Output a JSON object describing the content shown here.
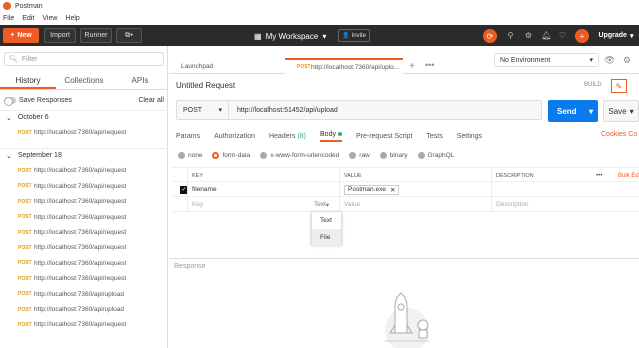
{
  "titlebar": {
    "app_name": "Postman"
  },
  "menu": [
    "File",
    "Edit",
    "View",
    "Help"
  ],
  "header": {
    "new_label": "New",
    "import_label": "Import",
    "runner_label": "Runner",
    "workspace_label": "My Workspace",
    "invite_label": "Invite",
    "upgrade_label": "Upgrade"
  },
  "sidebar": {
    "filter_placeholder": "Filter",
    "tabs": [
      "History",
      "Collections",
      "APIs"
    ],
    "save_responses_label": "Save Responses",
    "clear_all_label": "Clear all",
    "groups": [
      {
        "date": "October 6",
        "items": [
          {
            "method": "POST",
            "url": "http://localhost:7360/api/request"
          }
        ]
      },
      {
        "date": "September 18",
        "items": [
          {
            "method": "POST",
            "url": "http://localhost:7360/api/request"
          },
          {
            "method": "POST",
            "url": "http://localhost:7360/api/request"
          },
          {
            "method": "POST",
            "url": "http://localhost:7360/api/request"
          },
          {
            "method": "POST",
            "url": "http://localhost:7360/api/request"
          },
          {
            "method": "POST",
            "url": "http://localhost:7360/api/request"
          },
          {
            "method": "POST",
            "url": "http://localhost:7360/api/request"
          },
          {
            "method": "POST",
            "url": "http://localhost:7360/api/request"
          },
          {
            "method": "POST",
            "url": "http://localhost:7360/api/request"
          },
          {
            "method": "POST",
            "url": "http://localhost:7360/api/upload"
          },
          {
            "method": "POST",
            "url": "http://localhost:7360/api/upload"
          },
          {
            "method": "POST",
            "url": "http://localhost:7360/api/request"
          }
        ]
      }
    ]
  },
  "tabs": {
    "launchpad_label": "Launchpad",
    "active_method": "POST",
    "active_url": "http://localhost:7360/api/uplo..."
  },
  "environment": {
    "selected": "No Environment"
  },
  "request": {
    "title": "Untitled Request",
    "build_label": "BUILD",
    "method": "POST",
    "url": "http://localhost:51452/api/upload",
    "send_label": "Send",
    "save_label": "Save",
    "tabs": {
      "params": "Params",
      "authorization": "Authorization",
      "headers": "Headers",
      "headers_count": "(8)",
      "body": "Body",
      "pre_request": "Pre-request Script",
      "tests": "Tests",
      "settings": "Settings"
    },
    "cookies_label": "Cookies",
    "body_options": [
      "none",
      "form-data",
      "x-www-form-urlencoded",
      "raw",
      "binary",
      "GraphQL"
    ],
    "body_selected": "form-data",
    "table": {
      "headers": {
        "key": "KEY",
        "value": "VALUE",
        "description": "DESCRIPTION",
        "more": "•••",
        "bulk_edit": "Bulk Edit"
      },
      "row": {
        "key": "filename",
        "value": "Postman.exe",
        "checked": true
      },
      "placeholder": {
        "key": "Key",
        "type": "Text",
        "value": "Value",
        "description": "Description"
      }
    },
    "type_dropdown": [
      "Text",
      "File"
    ]
  },
  "response": {
    "label": "Response"
  },
  "colors": {
    "accent": "#ef5b25",
    "send": "#097bed",
    "header_bg": "#2b2b2b",
    "green": "#26b47f"
  }
}
